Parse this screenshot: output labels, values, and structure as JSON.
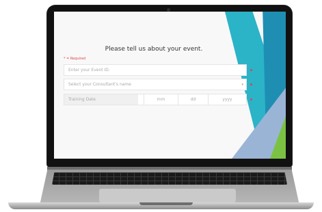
{
  "form": {
    "title": "Please tell us about your event.",
    "required_note": "* = Required",
    "event_id": {
      "placeholder": "Enter your Event ID."
    },
    "consultant": {
      "placeholder": "Select your Consultant's name"
    },
    "training_date": {
      "label": "Training Date",
      "month": "mm",
      "day": "dd",
      "year": "yyyy"
    }
  },
  "colors": {
    "required": "#e0424b",
    "stripe_teal": "#2bb3c7",
    "stripe_blue": "#1e8fb3",
    "stripe_lavender": "#9ab4d6",
    "stripe_green": "#7cc242"
  }
}
